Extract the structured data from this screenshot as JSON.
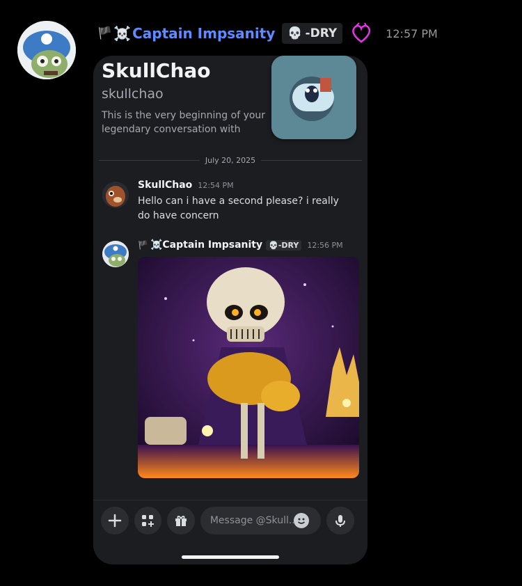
{
  "outer_message": {
    "flag": "🏴",
    "skull": "☠️",
    "author": "Captain Impsanity",
    "role_icon": "💀",
    "role_tag": "-DRY",
    "time": "12:57 PM",
    "colors": {
      "author": "#5e8cff",
      "heart": "#e834e8"
    }
  },
  "dm": {
    "title": "SkullChao",
    "username": "skullchao",
    "intro": "This is the very beginning of your legendary conversation with SkullChao.",
    "date_separator": "July 20, 2025",
    "messages": [
      {
        "author": "SkullChao",
        "time": "12:54 PM",
        "text": "Hello can i have a second please? i really do have concern"
      },
      {
        "flag": "🏴",
        "skull": "☠️",
        "author": "Captain Impsanity",
        "role_icon": "💀",
        "role_tag": "-DRY",
        "time": "12:56 PM",
        "attachment": "skeleton-gif"
      }
    ],
    "composer": {
      "placeholder": "Message @Skull..."
    },
    "icons": [
      "plus-icon",
      "apps-icon",
      "gift-icon",
      "emoji-icon",
      "microphone-icon"
    ]
  }
}
